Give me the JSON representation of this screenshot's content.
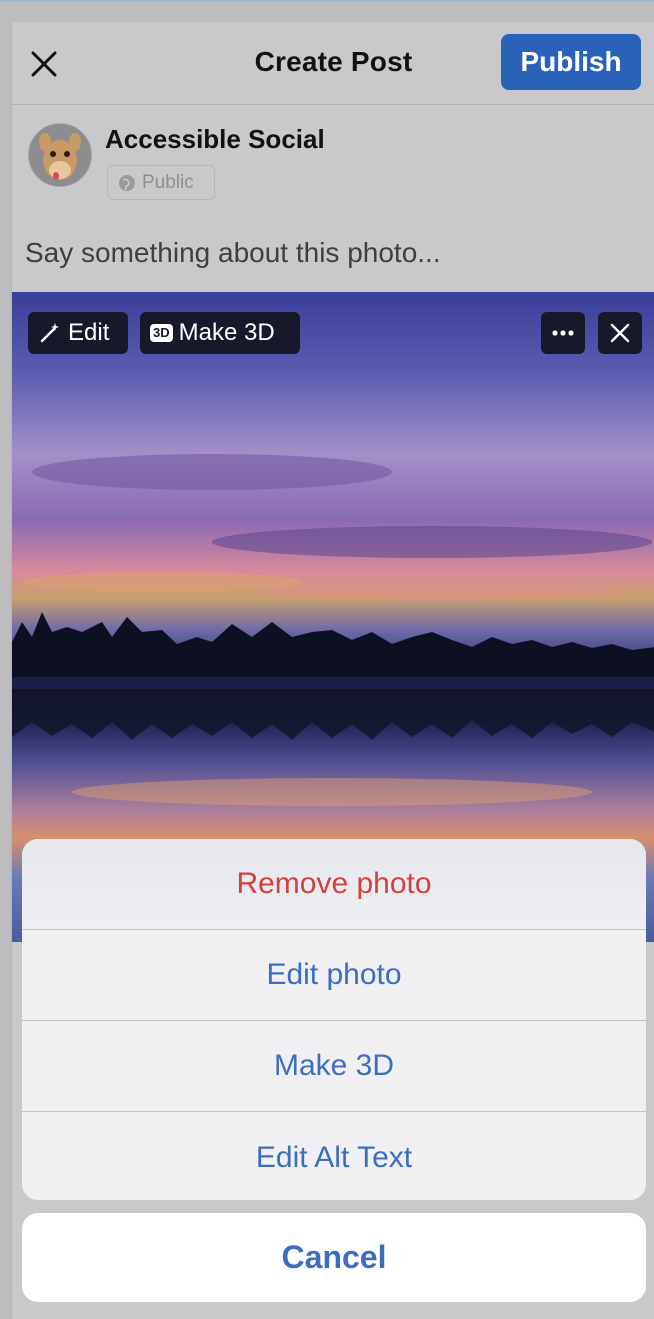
{
  "header": {
    "title": "Create Post",
    "publish_label": "Publish"
  },
  "account": {
    "name": "Accessible Social",
    "privacy": "Public"
  },
  "composer": {
    "placeholder": "Say something about this photo..."
  },
  "photo_toolbar": {
    "edit_label": "Edit",
    "make3d_badge": "3D",
    "make3d_label": "Make 3D"
  },
  "action_sheet": {
    "items": [
      {
        "label": "Remove photo"
      },
      {
        "label": "Edit photo"
      },
      {
        "label": "Make 3D"
      },
      {
        "label": "Edit Alt Text"
      }
    ],
    "cancel_label": "Cancel"
  },
  "colors": {
    "accent": "#2a62b9",
    "destructive": "#d0413f",
    "sheet_text": "#3b6fbd"
  }
}
